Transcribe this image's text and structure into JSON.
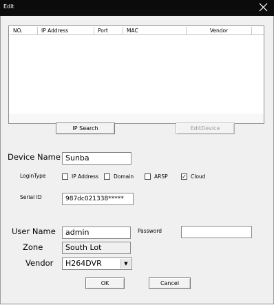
{
  "window": {
    "title": "Edit"
  },
  "listview": {
    "columns": [
      "NO.",
      "IP Address",
      "Port",
      "MAC",
      "Vendor"
    ]
  },
  "buttons": {
    "ip_search": "IP Search",
    "edit_device": "EditDevice",
    "ok": "OK",
    "cancel": "Cancel"
  },
  "device_name": {
    "label": "Device Name",
    "value": "Sunba"
  },
  "login_type": {
    "label": "LoginType",
    "options": [
      {
        "label": "IP Address",
        "checked": false
      },
      {
        "label": "Domain",
        "checked": false
      },
      {
        "label": "ARSP",
        "checked": false
      },
      {
        "label": "Cloud",
        "checked": true
      }
    ]
  },
  "serial_id": {
    "label": "Serial ID",
    "value": "987dc021338*****"
  },
  "user_name": {
    "label": "User Name",
    "value": "admin"
  },
  "password": {
    "label": "Password",
    "value": ""
  },
  "zone": {
    "label": "Zone",
    "value": "South Lot"
  },
  "vendor": {
    "label": "Vendor",
    "value": "H264DVR"
  }
}
